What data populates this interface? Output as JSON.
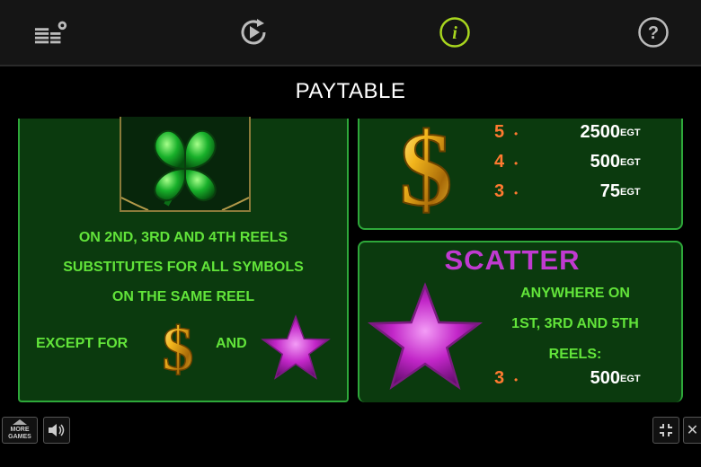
{
  "topbar": {
    "icons": [
      "settings-icon",
      "autoplay-icon",
      "info-icon",
      "help-icon"
    ],
    "info_symbol": "i",
    "help_symbol": "?"
  },
  "title": "PAYTABLE",
  "wild": {
    "lines": [
      "ON 2ND, 3RD AND 4TH REELS",
      "SUBSTITUTES FOR ALL SYMBOLS",
      "ON THE SAME REEL"
    ],
    "except_label": "EXCEPT FOR",
    "and_label": "AND"
  },
  "dollar": {
    "pays": [
      {
        "count": "5",
        "value": "2500",
        "currency": "EGT"
      },
      {
        "count": "4",
        "value": "500",
        "currency": "EGT"
      },
      {
        "count": "3",
        "value": "75",
        "currency": "EGT"
      }
    ]
  },
  "scatter": {
    "title": "SCATTER",
    "lines": [
      "ANYWHERE ON",
      "1ST, 3RD AND 5TH",
      "REELS:"
    ],
    "pays": [
      {
        "count": "3",
        "value": "500",
        "currency": "EGT"
      }
    ]
  },
  "bottom": {
    "more_games_lines": [
      "MORE",
      "GAMES"
    ],
    "close_symbol": "✕"
  },
  "colors": {
    "panel_bg": "#0b3a0e",
    "panel_border": "#2ea83a",
    "green_text": "#62e43a",
    "scatter_title": "#c03ad0",
    "pay_count": "#ff7a30",
    "info_icon": "#a8d61e"
  }
}
